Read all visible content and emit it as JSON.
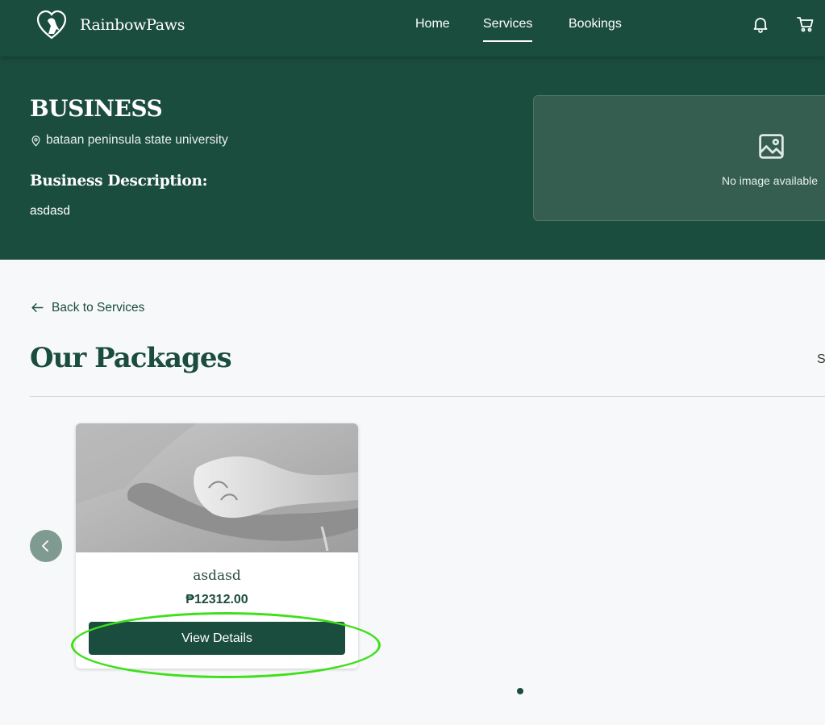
{
  "nav": {
    "brand": "RainbowPaws",
    "links": [
      {
        "label": "Home"
      },
      {
        "label": "Services",
        "active": true
      },
      {
        "label": "Bookings"
      }
    ],
    "icons": [
      "bell-icon",
      "cart-icon"
    ]
  },
  "hero": {
    "business_name": "BUSINESS",
    "location": "bataan peninsula state university",
    "description_title": "Business Description:",
    "description": "asdasd",
    "image_placeholder": "No image available"
  },
  "main": {
    "back_label": "Back to Services",
    "section_title": "Our Packages",
    "sort_label_partial": "S"
  },
  "packages": [
    {
      "name": "asdasd",
      "price": "₱12312.00",
      "button": "View Details"
    }
  ],
  "colors": {
    "primary": "#1b4d3e",
    "highlight": "#3ee01a"
  }
}
